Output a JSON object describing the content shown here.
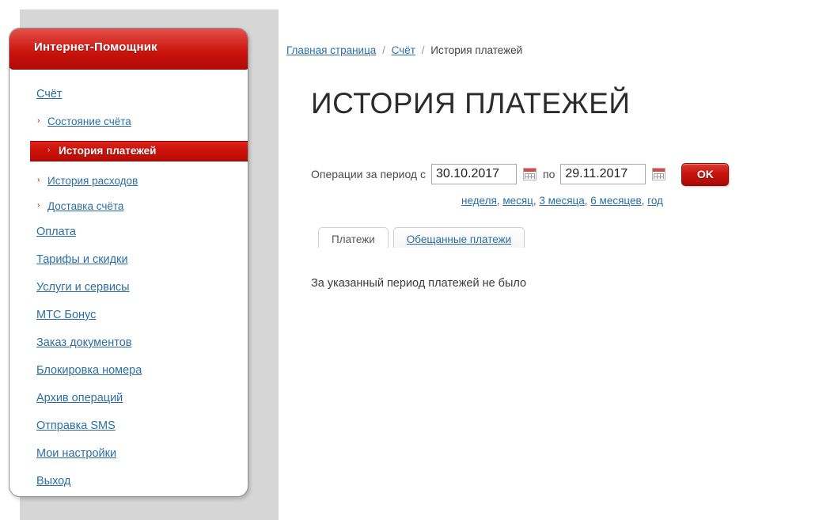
{
  "sidebar": {
    "header_title": "Интернет-Помощник",
    "items": [
      {
        "label": "Счёт",
        "type": "top"
      },
      {
        "label": "Состояние счёта",
        "type": "sub"
      },
      {
        "label": "История платежей",
        "type": "active"
      },
      {
        "label": "История расходов",
        "type": "sub"
      },
      {
        "label": "Доставка счёта",
        "type": "sub"
      },
      {
        "label": "Оплата",
        "type": "top"
      },
      {
        "label": "Тарифы и скидки",
        "type": "top"
      },
      {
        "label": "Услуги и сервисы",
        "type": "top"
      },
      {
        "label": "МТС Бонус",
        "type": "top"
      },
      {
        "label": "Заказ документов",
        "type": "top"
      },
      {
        "label": "Блокировка номера",
        "type": "top"
      },
      {
        "label": "Архив операций",
        "type": "top"
      },
      {
        "label": "Отправка SMS",
        "type": "top"
      },
      {
        "label": "Мои настройки",
        "type": "top"
      },
      {
        "label": "Выход",
        "type": "top"
      }
    ],
    "bullet_glyph": "›"
  },
  "breadcrumb": {
    "items": [
      {
        "label": "Главная страница",
        "link": true
      },
      {
        "label": "Счёт",
        "link": true
      },
      {
        "label": "История платежей",
        "link": false
      }
    ],
    "separator": "/"
  },
  "main": {
    "title": "ИСТОРИЯ ПЛАТЕЖЕЙ"
  },
  "filter": {
    "label_from": "Операции за период с",
    "date_from": "30.10.2017",
    "label_to": "по",
    "date_to": "29.11.2017",
    "submit_label": "OK",
    "calendar_icon": "calendar-icon"
  },
  "quick_ranges": [
    {
      "label": "неделя"
    },
    {
      "label": "месяц"
    },
    {
      "label": "3 месяца"
    },
    {
      "label": "6 месяцев"
    },
    {
      "label": "год"
    }
  ],
  "tabs": [
    {
      "label": "Платежи",
      "active": true
    },
    {
      "label": "Обещанные платежи",
      "active": false
    }
  ],
  "content": {
    "empty_message": "За указанный период платежей не было"
  },
  "colors": {
    "brand_red": "#c8110c",
    "link_blue": "#2c6ea4",
    "page_gray": "#d6d6d6"
  }
}
